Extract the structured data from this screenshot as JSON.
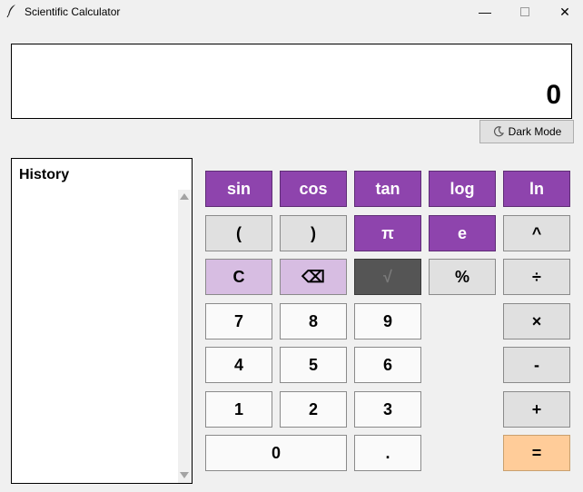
{
  "window": {
    "title": "Scientific Calculator",
    "minimize": "—",
    "maximize": "☐",
    "close": "✕"
  },
  "display": {
    "value": "0"
  },
  "toolbar": {
    "dark_mode_label": "Dark Mode"
  },
  "history": {
    "title": "History"
  },
  "keys": {
    "sin": "sin",
    "cos": "cos",
    "tan": "tan",
    "log": "log",
    "ln": "ln",
    "lparen": "(",
    "rparen": ")",
    "pi": "π",
    "e": "e",
    "pow": "^",
    "clear": "C",
    "backspace": "⌫",
    "sqrt": "√",
    "percent": "%",
    "divide": "÷",
    "n7": "7",
    "n8": "8",
    "n9": "9",
    "multiply": "×",
    "n4": "4",
    "n5": "5",
    "n6": "6",
    "minus": "-",
    "n1": "1",
    "n2": "2",
    "n3": "3",
    "plus": "+",
    "n0": "0",
    "dot": ".",
    "equals": "="
  },
  "colors": {
    "function_keys": "#8e44ad",
    "clear_keys": "#d7bde2",
    "sqrt_key": "#555555",
    "equals_key": "#ffcc99",
    "operator_keys": "#e0e0e0",
    "digit_keys": "#fafafa"
  }
}
